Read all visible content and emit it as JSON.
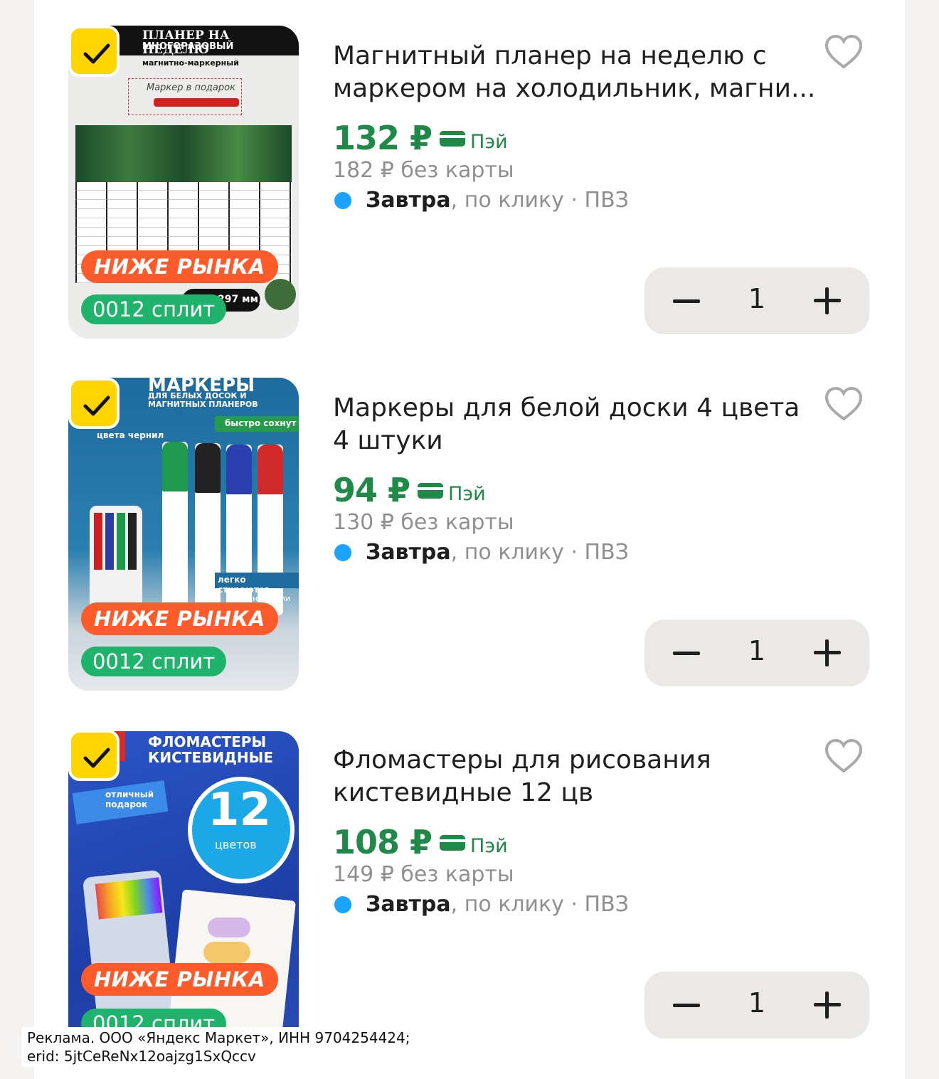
{
  "products": [
    {
      "title": "Магнитный планер на неделю с маркером на холодильник, магни...",
      "price": "132 ₽",
      "pay_label": "Пэй",
      "old_price": "182 ₽ без карты",
      "delivery_day": "Завтра",
      "delivery_rest": ", по клику · ПВЗ",
      "quantity": "1",
      "badge_market": "НИЖЕ РЫНКА",
      "badge_split": "0012 сплит",
      "image_texts": [
        "ПЛАНЕР НА НЕДЕЛЮ",
        "МНОГОРАЗОВЫЙ",
        "магнитно-маркерный",
        "Маркер в подарок",
        "297 мм)"
      ]
    },
    {
      "title": "Маркеры для белой доски 4 цвета 4 штуки",
      "price": "94 ₽",
      "pay_label": "Пэй",
      "old_price": "130 ₽ без карты",
      "delivery_day": "Завтра",
      "delivery_rest": ", по клику · ПВЗ",
      "quantity": "1",
      "badge_market": "НИЖЕ РЫНКА",
      "badge_split": "0012 сплит",
      "image_texts": [
        "МАРКЕРЫ",
        "ДЛЯ БЕЛЫХ ДОСОК И МАГНИТНЫХ ПЛАНЕРОВ",
        "быстро сохнут",
        "цвета чернил",
        "легко стираются",
        "ширина линии 1-4 мм"
      ]
    },
    {
      "title": "Фломастеры для рисования кистевидные 12 цв",
      "price": "108 ₽",
      "pay_label": "Пэй",
      "old_price": "149 ₽ без карты",
      "delivery_day": "Завтра",
      "delivery_rest": ", по клику · ПВЗ",
      "quantity": "1",
      "badge_market": "НИЖЕ РЫНКА",
      "badge_split": "0012 сплит",
      "image_texts": [
        "ФЛОМАСТЕРЫ КИСТЕВИДНЫЕ",
        "отличный подарок",
        "12",
        "цветов"
      ]
    }
  ],
  "ad_disclaimer": {
    "line1": "Реклама. ООО «Яндекс Маркет», ИНН 9704254424;",
    "line2": "erid: 5jtCeReNx12oajzg1SxQccv"
  },
  "colors": {
    "price_green": "#1f8a48",
    "check_yellow": "#ffd600",
    "badge_orange": "#ff5a2a",
    "badge_green": "#1fb36b",
    "delivery_dot": "#1aa3ff"
  }
}
